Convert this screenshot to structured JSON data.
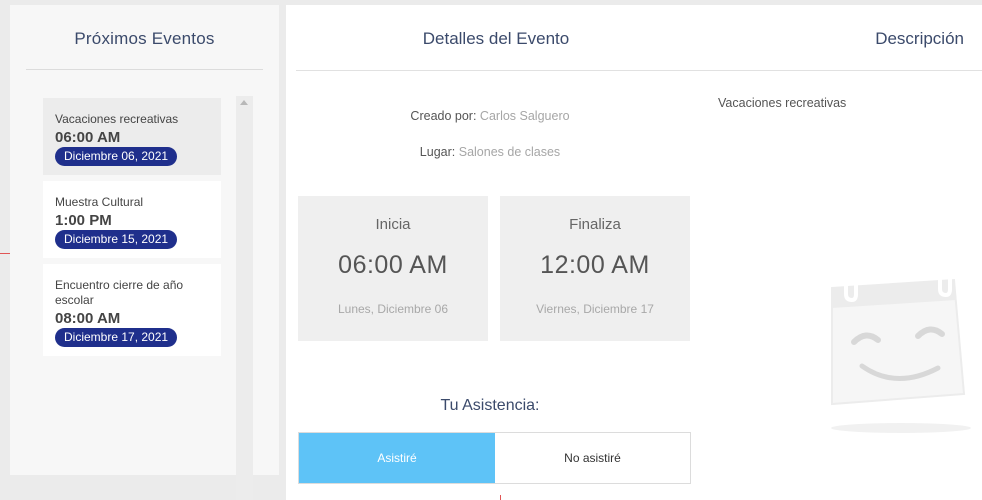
{
  "sidebar": {
    "title": "Próximos Eventos",
    "events": [
      {
        "name": "Vacaciones recreativas",
        "time": "06:00 AM",
        "date": "Diciembre 06, 2021"
      },
      {
        "name": "Muestra Cultural",
        "time": "1:00 PM",
        "date": "Diciembre 15, 2021"
      },
      {
        "name": "Encuentro cierre de año escolar",
        "time": "08:00 AM",
        "date": "Diciembre 17, 2021"
      }
    ]
  },
  "details": {
    "title": "Detalles del Evento",
    "created_by_label": "Creado por:",
    "created_by_value": "Carlos Salguero",
    "place_label": "Lugar:",
    "place_value": "Salones de clases",
    "start": {
      "label": "Inicia",
      "time": "06:00 AM",
      "day": "Lunes, Diciembre 06"
    },
    "end": {
      "label": "Finaliza",
      "time": "12:00 AM",
      "day": "Viernes, Diciembre 17"
    },
    "attendance_title": "Tu Asistencia:",
    "attend_yes": "Asistiré",
    "attend_no": "No asistiré"
  },
  "description": {
    "title": "Descripción",
    "text": "Vacaciones recreativas",
    "illustration_icon": "smiling-calendar-icon"
  },
  "colors": {
    "date_badge": "#1f2f8c",
    "attend_selected": "#5ec3f7",
    "heading": "#3b4a6b"
  }
}
